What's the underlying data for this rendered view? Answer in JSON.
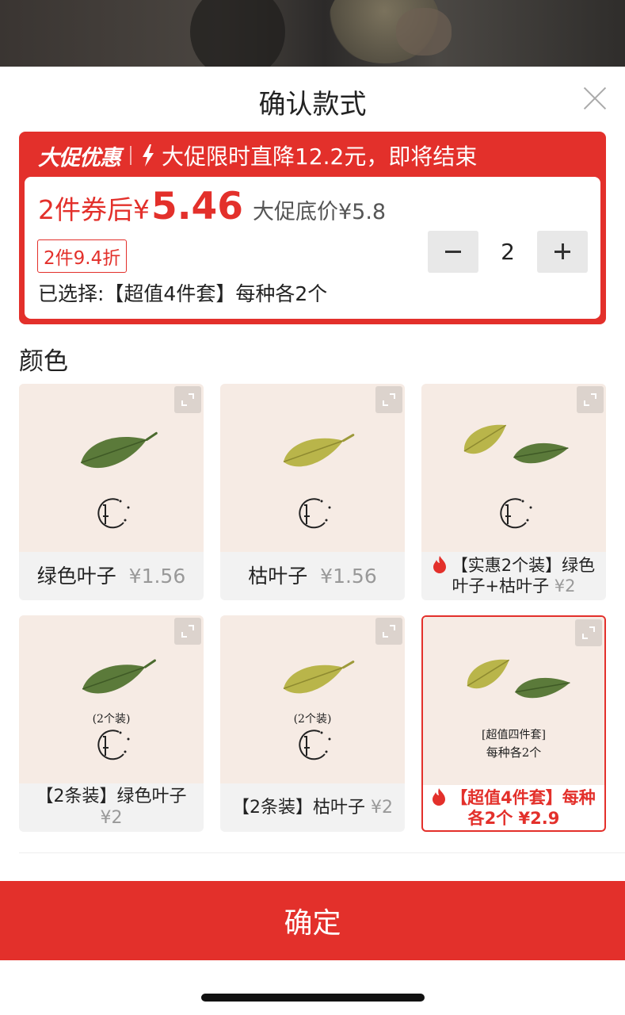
{
  "title": "确认款式",
  "promo": {
    "tag": "大促优惠",
    "text": "大促限时直降12.2元，即将结束",
    "price_prefix": "2件券后¥",
    "price_value": "5.46",
    "original_price": "大促底价¥5.8",
    "discount_badge": "2件9.4折",
    "selected_text": "已选择:【超值4件套】每种各2个",
    "quantity": "2"
  },
  "section_label": "颜色",
  "options": [
    {
      "name": "绿色叶子",
      "price": "¥1.56",
      "hot": false,
      "selected": false
    },
    {
      "name": "枯叶子",
      "price": "¥1.56",
      "hot": false,
      "selected": false
    },
    {
      "name": "【实惠2个装】绿色叶子+枯叶子",
      "price": "¥2",
      "hot": true,
      "selected": false
    },
    {
      "name": "【2条装】绿色叶子",
      "price": "¥2",
      "hot": false,
      "selected": false
    },
    {
      "name": "【2条装】枯叶子",
      "price": "¥2",
      "hot": false,
      "selected": false
    },
    {
      "name": "【超值4件套】每种各2个",
      "price": "¥2.9",
      "hot": true,
      "selected": true
    }
  ],
  "image_labels": {
    "two_pack": "(2个装)",
    "four_set_line1": "[超值四件套]",
    "four_set_line2": "每种各2个"
  },
  "confirm_label": "确定",
  "colors": {
    "accent": "#e3302b",
    "leaf_green": "#5b7a3a",
    "leaf_yellow": "#b9b54a",
    "card_bg": "#f6ebe4"
  }
}
